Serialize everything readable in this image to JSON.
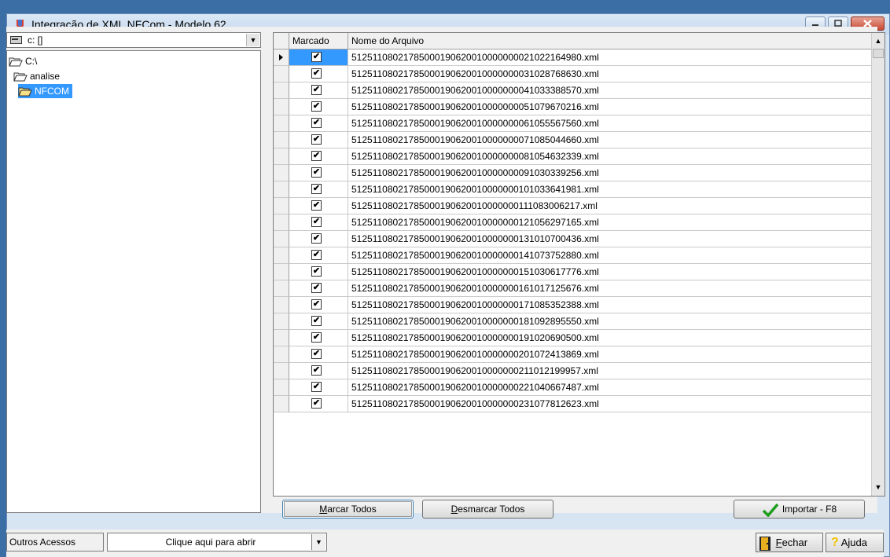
{
  "window": {
    "title": "Integração de XML NFCom  - Modelo 62"
  },
  "drive": {
    "selected": "c: []"
  },
  "folders": [
    {
      "label": "C:\\",
      "indent": 0,
      "selected": false
    },
    {
      "label": "analise",
      "indent": 1,
      "selected": false
    },
    {
      "label": "NFCOM",
      "indent": 2,
      "selected": true
    }
  ],
  "grid": {
    "columns": [
      "Marcado",
      "Nome do Arquivo"
    ],
    "rows": [
      {
        "checked": true,
        "file": "51251108021785000190620010000000021022164980.xml"
      },
      {
        "checked": true,
        "file": "51251108021785000190620010000000031028768630.xml"
      },
      {
        "checked": true,
        "file": "51251108021785000190620010000000041033388570.xml"
      },
      {
        "checked": true,
        "file": "51251108021785000190620010000000051079670216.xml"
      },
      {
        "checked": true,
        "file": "51251108021785000190620010000000061055567560.xml"
      },
      {
        "checked": true,
        "file": "51251108021785000190620010000000071085044660.xml"
      },
      {
        "checked": true,
        "file": "51251108021785000190620010000000081054632339.xml"
      },
      {
        "checked": true,
        "file": "51251108021785000190620010000000091030339256.xml"
      },
      {
        "checked": true,
        "file": "51251108021785000190620010000000101033641981.xml"
      },
      {
        "checked": true,
        "file": "51251108021785000190620010000000111083006217.xml"
      },
      {
        "checked": true,
        "file": "51251108021785000190620010000000121056297165.xml"
      },
      {
        "checked": true,
        "file": "51251108021785000190620010000000131010700436.xml"
      },
      {
        "checked": true,
        "file": "51251108021785000190620010000000141073752880.xml"
      },
      {
        "checked": true,
        "file": "51251108021785000190620010000000151030617776.xml"
      },
      {
        "checked": true,
        "file": "51251108021785000190620010000000161017125676.xml"
      },
      {
        "checked": true,
        "file": "51251108021785000190620010000000171085352388.xml"
      },
      {
        "checked": true,
        "file": "51251108021785000190620010000000181092895550.xml"
      },
      {
        "checked": true,
        "file": "51251108021785000190620010000000191020690500.xml"
      },
      {
        "checked": true,
        "file": "51251108021785000190620010000000201072413869.xml"
      },
      {
        "checked": true,
        "file": "51251108021785000190620010000000211012199957.xml"
      },
      {
        "checked": true,
        "file": "51251108021785000190620010000000221040667487.xml"
      },
      {
        "checked": true,
        "file": "51251108021785000190620010000000231077812623.xml"
      }
    ]
  },
  "actions": {
    "mark_all_key": "M",
    "mark_all_rest": "arcar Todos",
    "unmark_all_key": "D",
    "unmark_all_rest": "esmarcar Todos",
    "import_label": "Importar - F8"
  },
  "footer": {
    "other_access_label": "Outros Acessos",
    "other_access_value": "Clique aqui para abrir",
    "close_key": "F",
    "close_rest": "echar",
    "help_label": "Ajuda"
  },
  "colors": {
    "selection": "#3399ff",
    "title_bg": "#dbe8f6",
    "close_button": "#c74a33",
    "check_green": "#1e9e1e",
    "help_icon": "#f2c200"
  }
}
